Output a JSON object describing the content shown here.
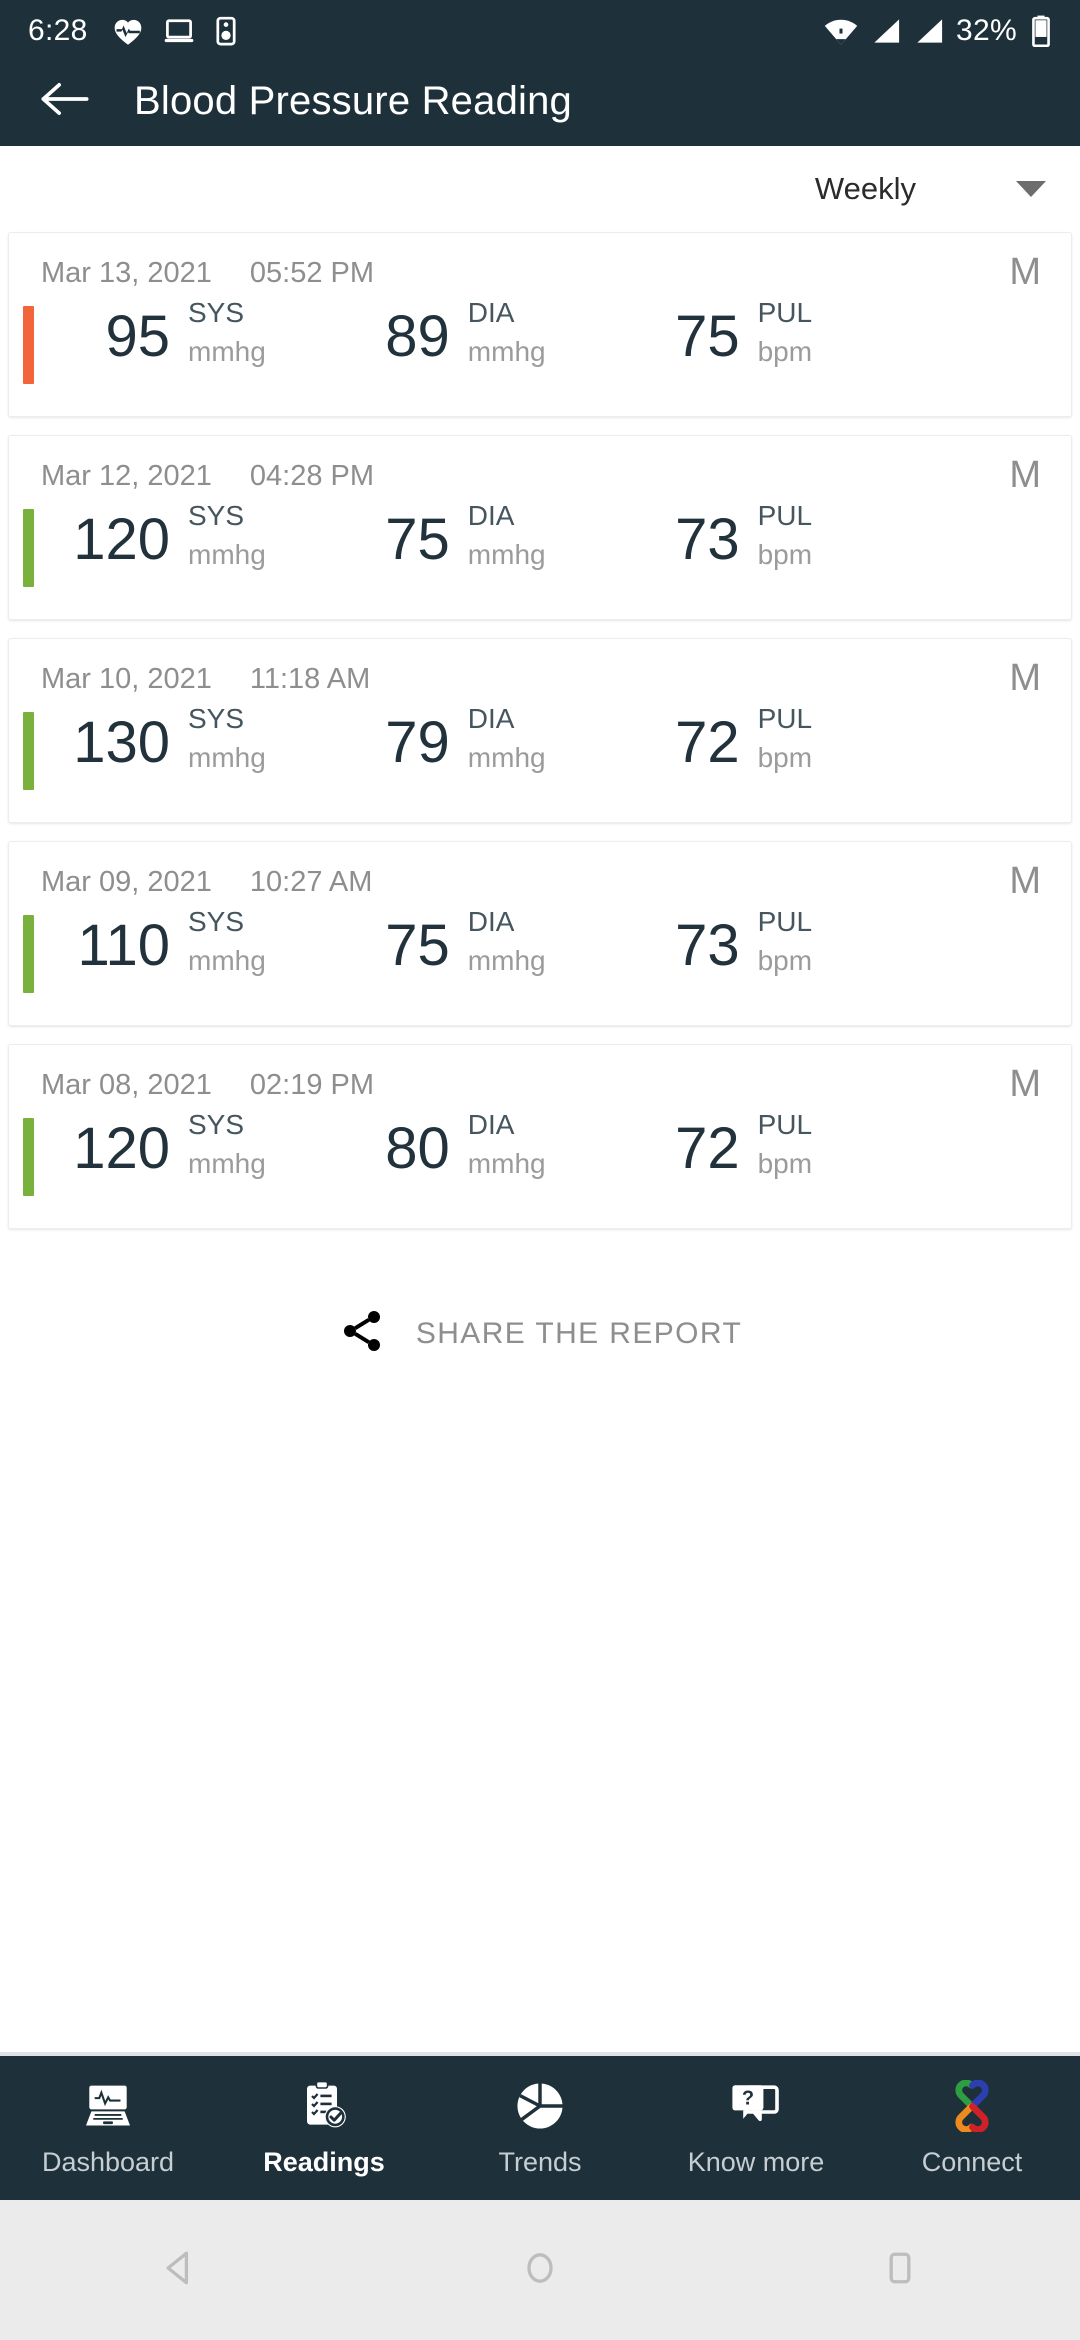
{
  "status_bar": {
    "time": "6:28",
    "battery_percent": "32%",
    "icons": [
      "heart-pulse-icon",
      "laptop-icon",
      "speaker-icon",
      "wifi-icon",
      "signal-icon",
      "signal-icon-2",
      "battery-icon"
    ]
  },
  "app_bar": {
    "back_icon": "arrow-left-icon",
    "title": "Blood Pressure Reading"
  },
  "filter": {
    "selected": "Weekly",
    "caret_icon": "chevron-down-icon"
  },
  "labels": {
    "sys": "SYS",
    "dia": "DIA",
    "pul": "PUL",
    "mmhg": "mmhg",
    "bpm": "bpm"
  },
  "colors": {
    "header_bg": "#1e313b",
    "accent_high": "#f2653a",
    "accent_normal": "#7ab03c",
    "value_text": "#22323c",
    "muted_text": "#9b9b9b"
  },
  "readings": [
    {
      "date": "Mar 13, 2021",
      "time": "05:52 PM",
      "tag": "M",
      "sys": "95",
      "dia": "89",
      "pul": "75",
      "status_color": "#f2653a"
    },
    {
      "date": "Mar 12, 2021",
      "time": "04:28 PM",
      "tag": "M",
      "sys": "120",
      "dia": "75",
      "pul": "73",
      "status_color": "#7ab03c"
    },
    {
      "date": "Mar 10, 2021",
      "time": "11:18 AM",
      "tag": "M",
      "sys": "130",
      "dia": "79",
      "pul": "72",
      "status_color": "#7ab03c"
    },
    {
      "date": "Mar 09, 2021",
      "time": "10:27 AM",
      "tag": "M",
      "sys": "110",
      "dia": "75",
      "pul": "73",
      "status_color": "#7ab03c"
    },
    {
      "date": "Mar 08, 2021",
      "time": "02:19 PM",
      "tag": "M",
      "sys": "120",
      "dia": "80",
      "pul": "72",
      "status_color": "#7ab03c"
    }
  ],
  "share": {
    "icon": "share-icon",
    "label": "SHARE THE REPORT"
  },
  "bottom_nav": {
    "items": [
      {
        "label": "Dashboard",
        "icon": "laptop-ecg-icon",
        "active": false
      },
      {
        "label": "Readings",
        "icon": "clipboard-check-icon",
        "active": true
      },
      {
        "label": "Trends",
        "icon": "pie-chart-icon",
        "active": false
      },
      {
        "label": "Know more",
        "icon": "question-bubble-icon",
        "active": false
      },
      {
        "label": "Connect",
        "icon": "connect-knot-icon",
        "active": false
      }
    ]
  },
  "android_nav": {
    "back": "triangle-back-icon",
    "home": "circle-home-icon",
    "recents": "square-recents-icon"
  }
}
